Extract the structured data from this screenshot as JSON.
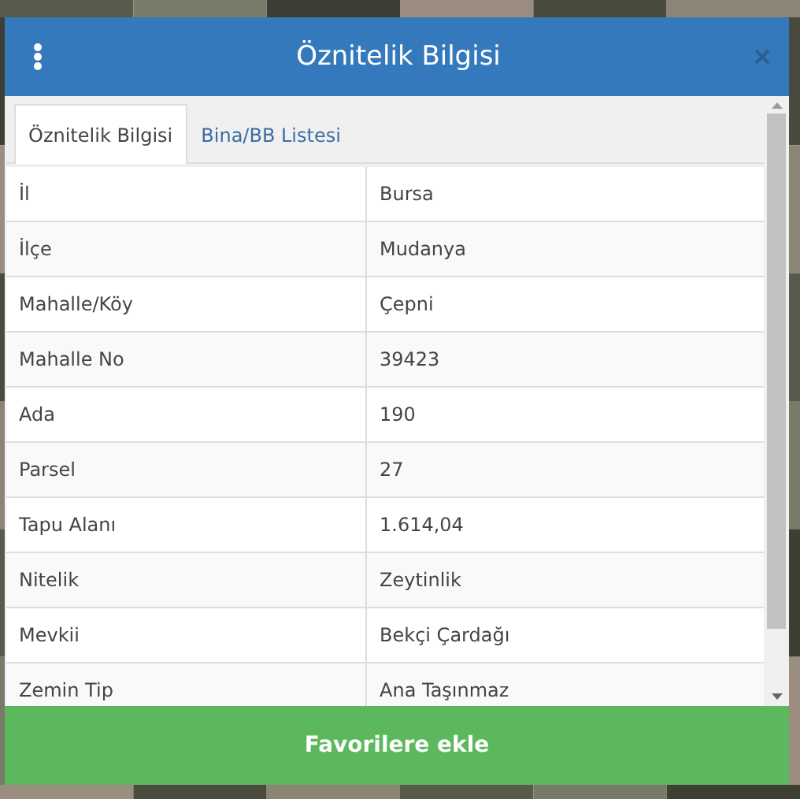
{
  "dialog": {
    "title": "Öznitelik Bilgisi"
  },
  "tabs": [
    {
      "label": "Öznitelik Bilgisi",
      "selected": true
    },
    {
      "label": "Bina/BB Listesi",
      "selected": false
    }
  ],
  "rows": [
    {
      "label": "İl",
      "value": "Bursa"
    },
    {
      "label": "İlçe",
      "value": "Mudanya"
    },
    {
      "label": "Mahalle/Köy",
      "value": "Çepni"
    },
    {
      "label": "Mahalle No",
      "value": "39423"
    },
    {
      "label": "Ada",
      "value": "190"
    },
    {
      "label": "Parsel",
      "value": "27"
    },
    {
      "label": "Tapu Alanı",
      "value": "1.614,04"
    },
    {
      "label": "Nitelik",
      "value": "Zeytinlik"
    },
    {
      "label": "Mevkii",
      "value": "Bekçi Çardağı"
    },
    {
      "label": "Zemin Tip",
      "value": "Ana Taşınmaz"
    }
  ],
  "button": {
    "label": "Favorilere ekle"
  }
}
